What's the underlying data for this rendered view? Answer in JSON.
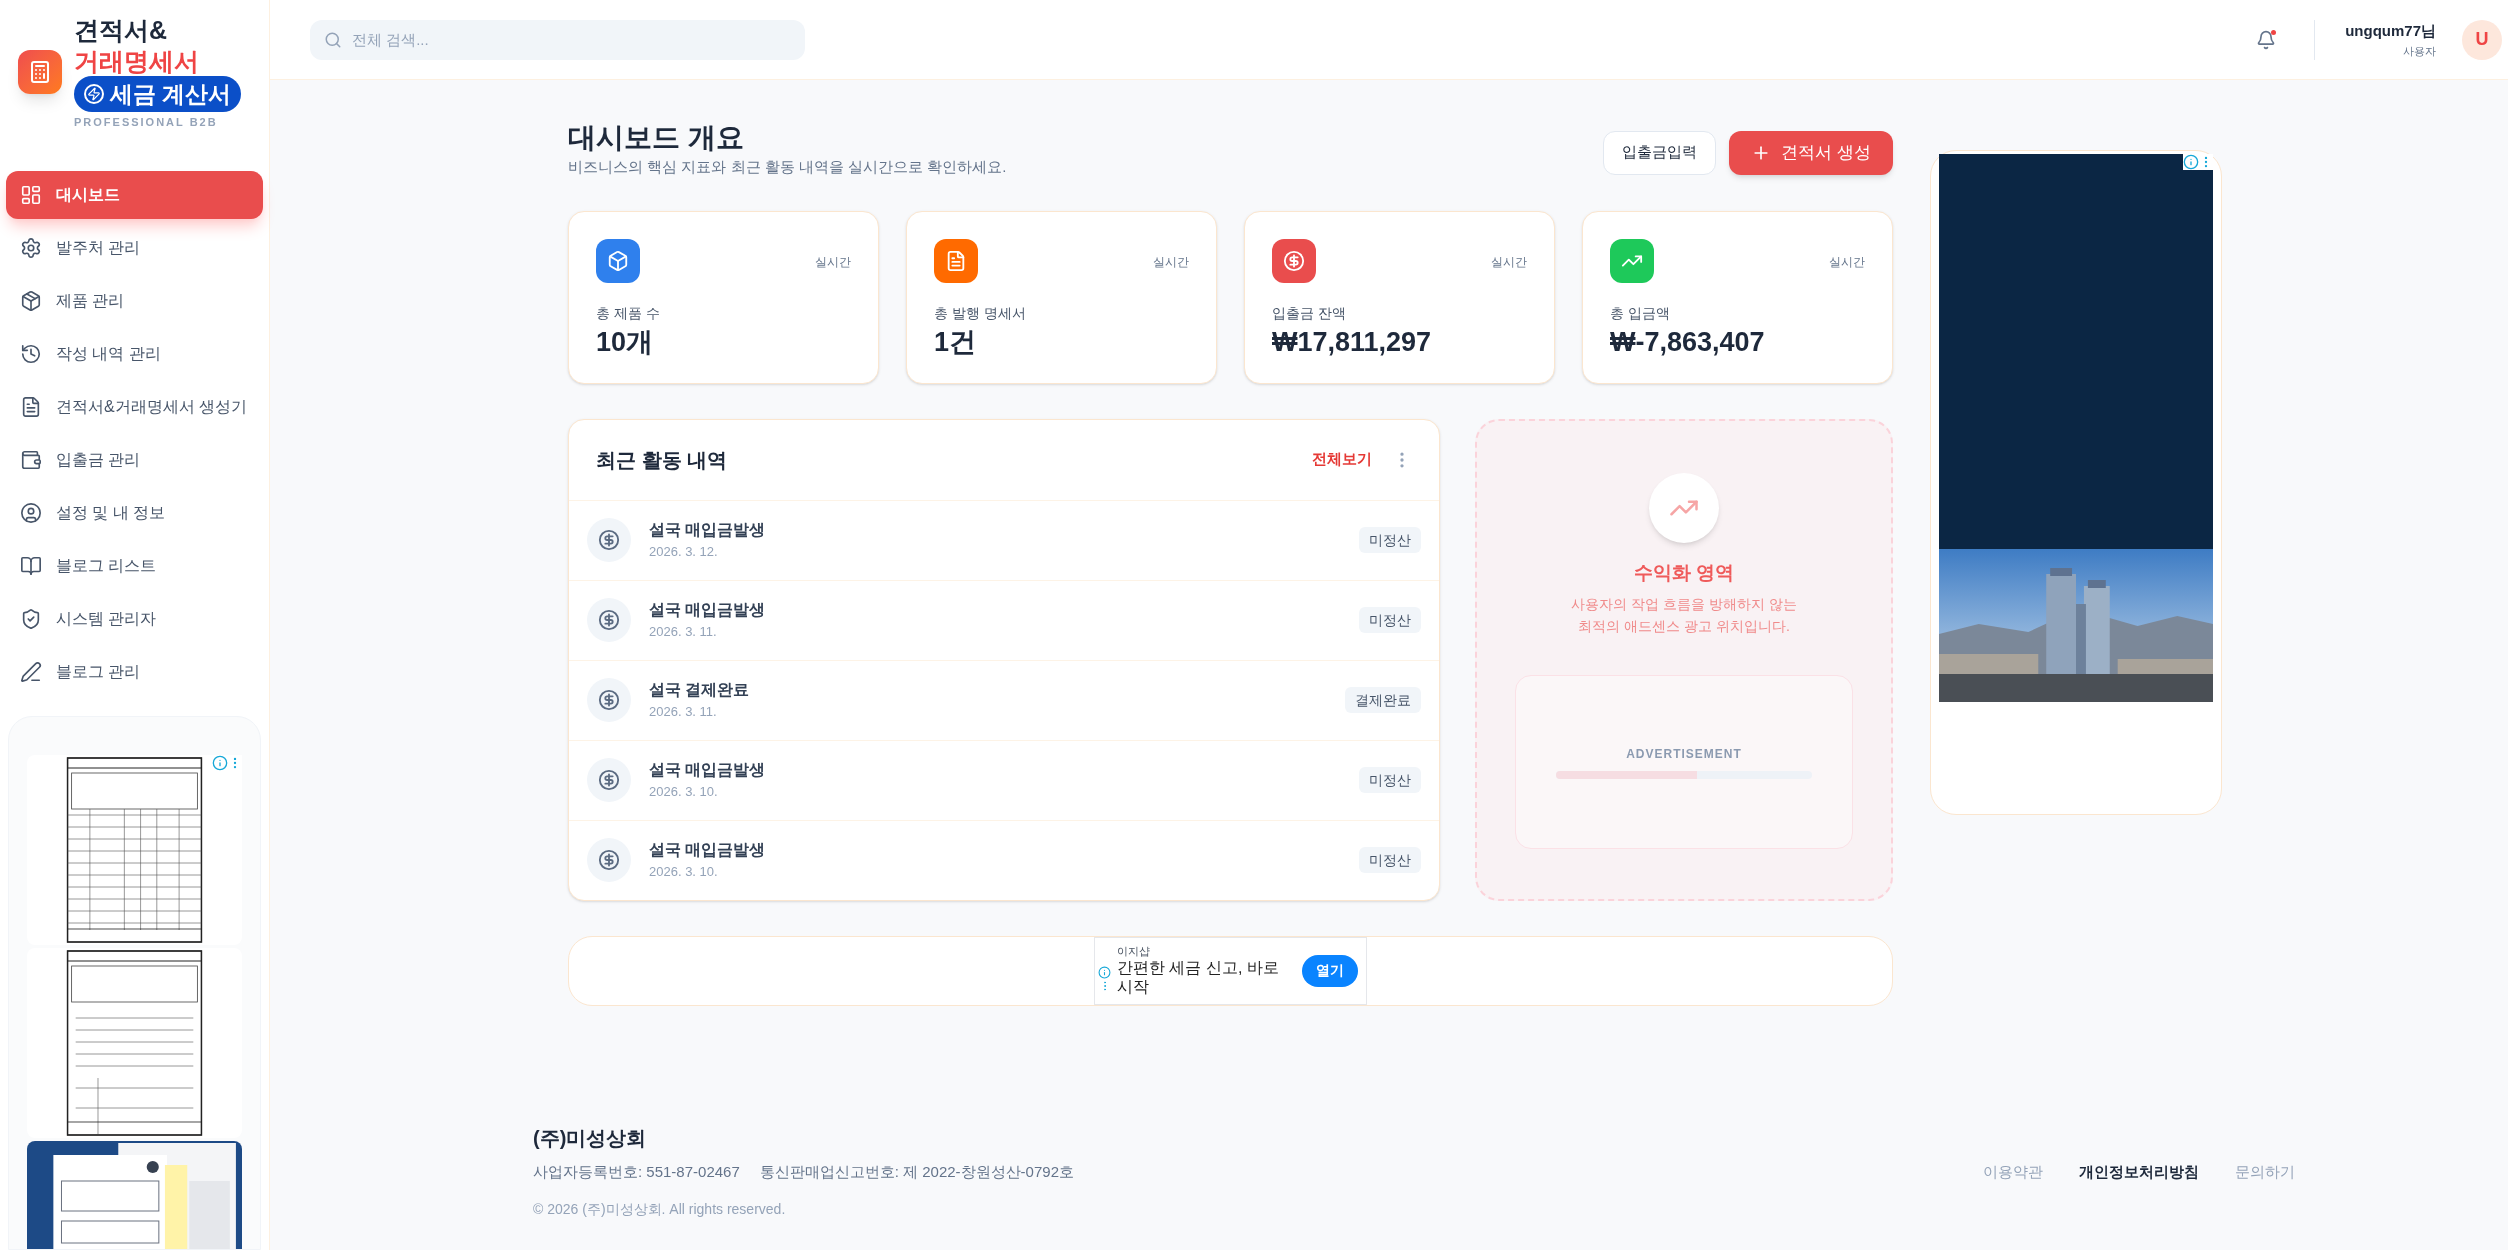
{
  "sidebar": {
    "logo": {
      "line1": "견적서&",
      "line2": "거래명세서",
      "badge": "세금 계산서",
      "tagline": "PROFESSIONAL B2B"
    },
    "nav": [
      {
        "label": "대시보드",
        "selected": true
      },
      {
        "label": "발주처 관리",
        "selected": false
      },
      {
        "label": "제품 관리",
        "selected": false
      },
      {
        "label": "작성 내역 관리",
        "selected": false
      },
      {
        "label": "견적서&거래명세서 생성기",
        "selected": false
      },
      {
        "label": "입출금 관리",
        "selected": false
      },
      {
        "label": "설정 및 내 정보",
        "selected": false
      },
      {
        "label": "블로그 리스트",
        "selected": false
      },
      {
        "label": "시스템 관리자",
        "selected": false
      },
      {
        "label": "블로그 관리",
        "selected": false
      }
    ]
  },
  "header": {
    "search": {
      "placeholder": "전체 검색..."
    },
    "user": {
      "name": "ungqum77님",
      "role": "사용자",
      "avatar": "U"
    }
  },
  "page": {
    "title": "대시보드 개요",
    "subtitle": "비즈니스의 핵심 지표와 최근 활동 내역을 실시간으로 확인하세요.",
    "buttons": [
      {
        "label": "입출금입력",
        "kind": "secondary"
      },
      {
        "label": "견적서 생성",
        "kind": "primary"
      }
    ]
  },
  "stats": [
    {
      "color": "#2f80ed",
      "badge": "실시간",
      "label": "총 제품 수",
      "value": "10개"
    },
    {
      "color": "#ff6a00",
      "badge": "실시간",
      "label": "총 발행 명세서",
      "value": "1건"
    },
    {
      "color": "#e94d4d",
      "badge": "실시간",
      "label": "입출금 잔액",
      "value": "₩17,811,297"
    },
    {
      "color": "#1ec95a",
      "badge": "실시간",
      "label": "총 입금액",
      "value": "₩-7,863,407"
    }
  ],
  "activity": {
    "title": "최근 활동 내역",
    "link": "전체보기",
    "items": [
      {
        "title": "설국 매입금발생",
        "date": "2026. 3. 12.",
        "status": "미정산"
      },
      {
        "title": "설국 매입금발생",
        "date": "2026. 3. 11.",
        "status": "미정산"
      },
      {
        "title": "설국 결제완료",
        "date": "2026. 3. 11.",
        "status": "결제완료"
      },
      {
        "title": "설국 매입금발생",
        "date": "2026. 3. 10.",
        "status": "미정산"
      },
      {
        "title": "설국 매입금발생",
        "date": "2026. 3. 10.",
        "status": "미정산"
      }
    ]
  },
  "monetization": {
    "title": "수익화 영역",
    "text": "사용자의 작업 흐름을 방해하지 않는\n최적의 애드센스 광고 위치입니다.",
    "ad_label": "ADVERTISEMENT",
    "level": 0.55
  },
  "bottom_ad": {
    "advertiser": "이지샵",
    "headline": "간편한 세금 신고, 바로\n시작",
    "button": "열기"
  },
  "footer": {
    "company": "(주)미성상회",
    "info": [
      "사업자등록번호: 551-87-02467",
      "통신판매업신고번호: 제 2022-창원성산-0792호"
    ],
    "links": [
      {
        "label": "이용약관",
        "emphasized": false
      },
      {
        "label": "개인정보처리방침",
        "emphasized": true
      },
      {
        "label": "문의하기",
        "emphasized": false
      }
    ],
    "copyright": "© 2026 (주)미성상회. All rights reserved."
  }
}
